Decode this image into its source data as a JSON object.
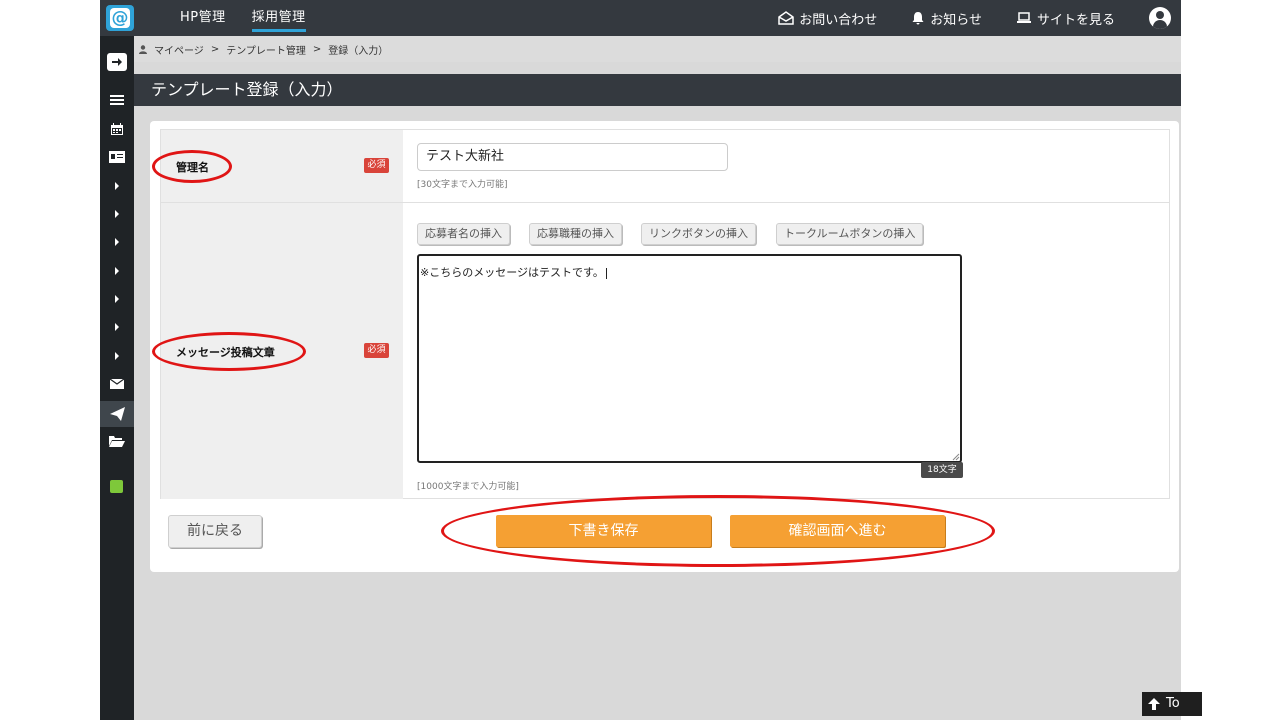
{
  "header": {
    "logo_icon": "at-sign-logo",
    "tabs": [
      {
        "label": "HP管理",
        "active": false
      },
      {
        "label": "採用管理",
        "active": true
      }
    ],
    "contact_label": "お問い合わせ",
    "notice_label": "お知らせ",
    "site_label": "サイトを見る"
  },
  "breadcrumb": {
    "items": [
      "マイページ",
      "テンプレート管理",
      "登録（入力）"
    ],
    "separator": ">"
  },
  "page": {
    "title": "テンプレート登録（入力）"
  },
  "form": {
    "required_badge": "必須",
    "name_field": {
      "label": "管理名",
      "value": "テスト大新社",
      "hint": "[30文字まで入力可能]"
    },
    "message_field": {
      "label": "メッセージ投稿文章",
      "insert_buttons": [
        "応募者名の挿入",
        "応募職種の挿入",
        "リンクボタンの挿入",
        "トークルームボタンの挿入"
      ],
      "value": "※こちらのメッセージはテストです。",
      "char_count": "18文字",
      "hint": "[1000文字まで入力可能]"
    }
  },
  "actions": {
    "back_label": "前に戻る",
    "draft_label": "下書き保存",
    "confirm_label": "確認画面へ進む"
  },
  "to_top": {
    "label": "To"
  },
  "colors": {
    "accent": "#2fa3d8",
    "primary_button": "#f5a033",
    "required_badge": "#d9443a",
    "annotation_ring": "#e01515",
    "topbar": "#34393f",
    "sidebar": "#1f2326"
  }
}
